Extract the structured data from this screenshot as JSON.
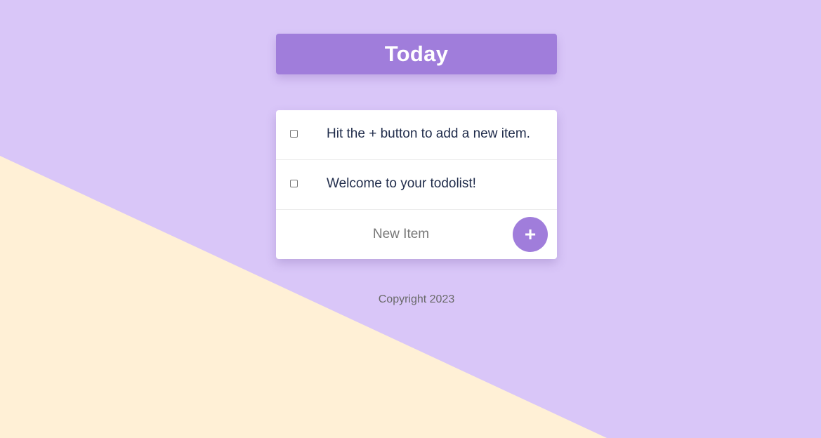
{
  "header": {
    "title": "Today"
  },
  "todo_list": {
    "items": [
      {
        "text": "Hit the + button to add a new item.",
        "checked": false
      },
      {
        "text": "Welcome to your todolist!",
        "checked": false
      }
    ],
    "new_item": {
      "placeholder": "New Item",
      "add_label": "+"
    }
  },
  "footer": {
    "copyright": "Copyright 2023"
  },
  "colors": {
    "background": "#d9c6f8",
    "triangle": "#fff0d6",
    "accent": "#a07ddb",
    "card": "#ffffff"
  }
}
